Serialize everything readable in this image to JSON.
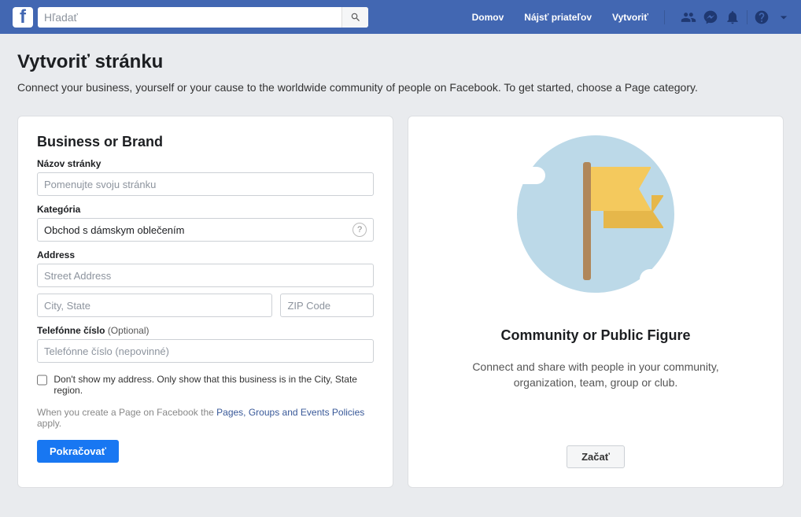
{
  "header": {
    "search_placeholder": "Hľadať",
    "links": {
      "home": "Domov",
      "find_friends": "Nájsť priateľov",
      "create": "Vytvoriť"
    }
  },
  "page": {
    "title": "Vytvoriť stránku",
    "subtitle": "Connect your business, yourself or your cause to the worldwide community of people on Facebook. To get started, choose a Page category."
  },
  "left_card": {
    "heading": "Business or Brand",
    "name_label": "Názov stránky",
    "name_placeholder": "Pomenujte svoju stránku",
    "category_label": "Kategória",
    "category_value": "Obchod s dámskym oblečením",
    "address_label": "Address",
    "street_placeholder": "Street Address",
    "city_placeholder": "City, State",
    "zip_placeholder": "ZIP Code",
    "phone_label": "Telefónne číslo",
    "phone_optional": "(Optional)",
    "phone_placeholder": "Telefónne číslo (nepovinné)",
    "hide_addr_text": "Don't show my address. Only show that this business is in the City, State region.",
    "policy_prefix": "When you create a Page on Facebook the ",
    "policy_link": "Pages, Groups and Events Policies",
    "policy_suffix": " apply.",
    "continue_btn": "Pokračovať"
  },
  "right_card": {
    "heading": "Community or Public Figure",
    "description": "Connect and share with people in your community, organization, team, group or club.",
    "start_btn": "Začať"
  }
}
